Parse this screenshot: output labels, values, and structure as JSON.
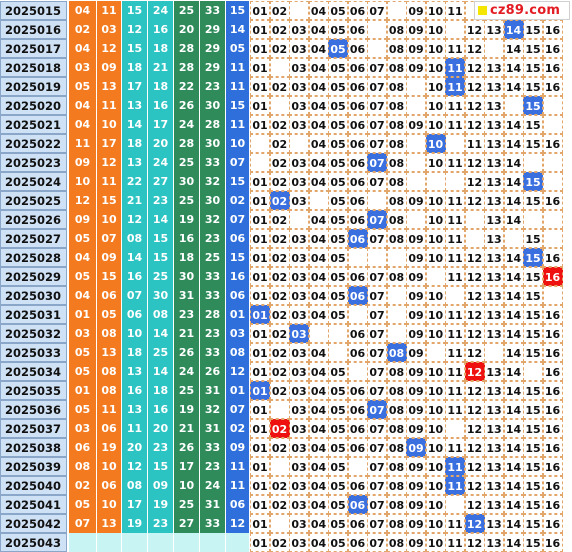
{
  "site": {
    "logo_text": "cz89.com"
  },
  "colors": {
    "orange": "#f47a1f",
    "teal": "#2cc3c3",
    "green": "#2f8c5a",
    "blue_ball": "#2f6fdc",
    "highlight_red": "#ef1010",
    "period_bg": "#cfe1f5",
    "empty_red_bg": "#c9f4f4"
  },
  "rows": [
    {
      "period": "2025015",
      "reds": [
        "04",
        "11",
        "15",
        "24",
        "25",
        "33"
      ],
      "blue": "15",
      "dist": [
        "01",
        "02",
        "",
        "04",
        "05",
        "06",
        "07",
        "",
        "09",
        "10",
        "11",
        "",
        "",
        "",
        "",
        ""
      ],
      "hits": []
    },
    {
      "period": "2025016",
      "reds": [
        "02",
        "03",
        "12",
        "16",
        "20",
        "29"
      ],
      "blue": "14",
      "dist": [
        "01",
        "02",
        "03",
        "04",
        "05",
        "06",
        "",
        "08",
        "09",
        "10",
        "",
        "12",
        "13",
        "14",
        "15",
        "16"
      ],
      "hits": [
        14
      ]
    },
    {
      "period": "2025017",
      "reds": [
        "04",
        "12",
        "15",
        "18",
        "28",
        "29"
      ],
      "blue": "05",
      "dist": [
        "01",
        "02",
        "03",
        "04",
        "05",
        "06",
        "",
        "08",
        "09",
        "10",
        "11",
        "12",
        "",
        "14",
        "15",
        "16"
      ],
      "hits": [
        5
      ]
    },
    {
      "period": "2025018",
      "reds": [
        "03",
        "09",
        "18",
        "21",
        "28",
        "29"
      ],
      "blue": "11",
      "dist": [
        "01",
        "",
        "03",
        "04",
        "05",
        "06",
        "07",
        "08",
        "09",
        "10",
        "11",
        "12",
        "13",
        "14",
        "15",
        "16"
      ],
      "hits": [
        11
      ]
    },
    {
      "period": "2025019",
      "reds": [
        "05",
        "13",
        "17",
        "18",
        "22",
        "23"
      ],
      "blue": "11",
      "dist": [
        "01",
        "02",
        "03",
        "04",
        "05",
        "06",
        "07",
        "08",
        "",
        "10",
        "11",
        "12",
        "13",
        "14",
        "15",
        "16"
      ],
      "hits": [
        11
      ]
    },
    {
      "period": "2025020",
      "reds": [
        "04",
        "11",
        "13",
        "16",
        "26",
        "30"
      ],
      "blue": "15",
      "dist": [
        "01",
        "",
        "03",
        "04",
        "05",
        "06",
        "07",
        "08",
        "",
        "10",
        "11",
        "12",
        "13",
        "",
        "15",
        ""
      ],
      "hits": [
        15
      ]
    },
    {
      "period": "2025021",
      "reds": [
        "04",
        "10",
        "14",
        "17",
        "24",
        "28"
      ],
      "blue": "11",
      "dist": [
        "01",
        "02",
        "03",
        "04",
        "05",
        "06",
        "07",
        "08",
        "09",
        "10",
        "11",
        "12",
        "13",
        "14",
        "15",
        ""
      ],
      "hits": []
    },
    {
      "period": "2025022",
      "reds": [
        "11",
        "17",
        "18",
        "20",
        "28",
        "30"
      ],
      "blue": "10",
      "dist": [
        "",
        "02",
        "",
        "04",
        "05",
        "06",
        "07",
        "08",
        "",
        "10",
        "",
        "11",
        "13",
        "14",
        "15",
        "16"
      ],
      "hits": [
        10
      ]
    },
    {
      "period": "2025023",
      "reds": [
        "09",
        "12",
        "13",
        "24",
        "25",
        "33"
      ],
      "blue": "07",
      "dist": [
        "",
        "02",
        "03",
        "04",
        "05",
        "06",
        "07",
        "08",
        "",
        "10",
        "11",
        "12",
        "13",
        "14",
        "",
        ""
      ],
      "hits": [
        7
      ]
    },
    {
      "period": "2025024",
      "reds": [
        "10",
        "11",
        "22",
        "27",
        "30",
        "32"
      ],
      "blue": "15",
      "dist": [
        "01",
        "02",
        "03",
        "04",
        "05",
        "06",
        "07",
        "08",
        "",
        "",
        "",
        "12",
        "13",
        "14",
        "15",
        ""
      ],
      "hits": [
        15
      ]
    },
    {
      "period": "2025025",
      "reds": [
        "12",
        "15",
        "21",
        "23",
        "25",
        "30"
      ],
      "blue": "02",
      "dist": [
        "01",
        "02",
        "03",
        "",
        "05",
        "06",
        "",
        "08",
        "09",
        "10",
        "11",
        "12",
        "13",
        "14",
        "15",
        "16"
      ],
      "hits": [
        2
      ]
    },
    {
      "period": "2025026",
      "reds": [
        "09",
        "10",
        "12",
        "14",
        "19",
        "32"
      ],
      "blue": "07",
      "dist": [
        "01",
        "02",
        "",
        "04",
        "05",
        "06",
        "07",
        "08",
        "",
        "10",
        "11",
        "",
        "13",
        "14",
        "",
        ""
      ],
      "hits": [
        7
      ]
    },
    {
      "period": "2025027",
      "reds": [
        "05",
        "07",
        "08",
        "15",
        "16",
        "23"
      ],
      "blue": "06",
      "dist": [
        "01",
        "02",
        "03",
        "04",
        "05",
        "06",
        "07",
        "08",
        "09",
        "10",
        "11",
        "",
        "13",
        "",
        "15",
        ""
      ],
      "hits": [
        6
      ]
    },
    {
      "period": "2025028",
      "reds": [
        "04",
        "09",
        "14",
        "15",
        "18",
        "25"
      ],
      "blue": "15",
      "dist": [
        "01",
        "02",
        "03",
        "04",
        "05",
        "",
        "",
        "",
        "09",
        "10",
        "11",
        "12",
        "13",
        "14",
        "15",
        "16"
      ],
      "hits": [
        15
      ]
    },
    {
      "period": "2025029",
      "reds": [
        "05",
        "15",
        "16",
        "25",
        "30",
        "33"
      ],
      "blue": "16",
      "dist": [
        "01",
        "02",
        "03",
        "04",
        "05",
        "06",
        "07",
        "08",
        "09",
        "",
        "11",
        "12",
        "13",
        "14",
        "15",
        "16"
      ],
      "hits": [
        16
      ]
    },
    {
      "period": "2025030",
      "reds": [
        "04",
        "06",
        "07",
        "30",
        "31",
        "33"
      ],
      "blue": "06",
      "dist": [
        "01",
        "02",
        "03",
        "04",
        "05",
        "06",
        "07",
        "",
        "09",
        "10",
        "",
        "12",
        "13",
        "14",
        "15",
        ""
      ],
      "hits": [
        6
      ]
    },
    {
      "period": "2025031",
      "reds": [
        "01",
        "05",
        "06",
        "08",
        "23",
        "28"
      ],
      "blue": "01",
      "dist": [
        "01",
        "02",
        "03",
        "04",
        "05",
        "",
        "07",
        "",
        "09",
        "10",
        "11",
        "12",
        "13",
        "14",
        "15",
        "16"
      ],
      "hits": [
        1
      ]
    },
    {
      "period": "2025032",
      "reds": [
        "03",
        "08",
        "10",
        "14",
        "21",
        "23"
      ],
      "blue": "03",
      "dist": [
        "01",
        "02",
        "03",
        "",
        "",
        "06",
        "07",
        "",
        "09",
        "10",
        "11",
        "12",
        "13",
        "14",
        "15",
        "16"
      ],
      "hits": [
        3
      ]
    },
    {
      "period": "2025033",
      "reds": [
        "05",
        "13",
        "18",
        "25",
        "26",
        "33"
      ],
      "blue": "08",
      "dist": [
        "01",
        "02",
        "03",
        "04",
        "",
        "06",
        "07",
        "08",
        "09",
        "",
        "11",
        "12",
        "",
        "14",
        "15",
        "16"
      ],
      "hits": [
        8
      ]
    },
    {
      "period": "2025034",
      "reds": [
        "05",
        "08",
        "13",
        "14",
        "24",
        "26"
      ],
      "blue": "12",
      "dist": [
        "01",
        "02",
        "03",
        "04",
        "05",
        "",
        "07",
        "08",
        "09",
        "10",
        "11",
        "12",
        "13",
        "14",
        "",
        "16"
      ],
      "hits": [
        12
      ]
    },
    {
      "period": "2025035",
      "reds": [
        "01",
        "08",
        "16",
        "18",
        "25",
        "31"
      ],
      "blue": "01",
      "dist": [
        "01",
        "02",
        "03",
        "04",
        "05",
        "06",
        "07",
        "08",
        "09",
        "10",
        "11",
        "12",
        "13",
        "14",
        "15",
        "16"
      ],
      "hits": [
        1
      ]
    },
    {
      "period": "2025036",
      "reds": [
        "05",
        "11",
        "13",
        "16",
        "19",
        "32"
      ],
      "blue": "07",
      "dist": [
        "01",
        "",
        "03",
        "04",
        "05",
        "06",
        "07",
        "08",
        "09",
        "10",
        "11",
        "12",
        "13",
        "14",
        "15",
        "16"
      ],
      "hits": [
        7
      ]
    },
    {
      "period": "2025037",
      "reds": [
        "03",
        "06",
        "11",
        "20",
        "21",
        "31"
      ],
      "blue": "02",
      "dist": [
        "01",
        "02",
        "03",
        "04",
        "05",
        "06",
        "07",
        "08",
        "09",
        "10",
        "",
        "12",
        "13",
        "14",
        "15",
        "16"
      ],
      "hits": [
        2
      ]
    },
    {
      "period": "2025038",
      "reds": [
        "06",
        "19",
        "20",
        "23",
        "26",
        "33"
      ],
      "blue": "09",
      "dist": [
        "01",
        "02",
        "03",
        "04",
        "05",
        "06",
        "07",
        "08",
        "09",
        "10",
        "11",
        "12",
        "13",
        "14",
        "15",
        "16"
      ],
      "hits": [
        9
      ]
    },
    {
      "period": "2025039",
      "reds": [
        "08",
        "10",
        "12",
        "15",
        "17",
        "23"
      ],
      "blue": "11",
      "dist": [
        "01",
        "",
        "03",
        "04",
        "05",
        "",
        "07",
        "08",
        "09",
        "10",
        "11",
        "12",
        "13",
        "14",
        "15",
        "16"
      ],
      "hits": [
        11
      ]
    },
    {
      "period": "2025040",
      "reds": [
        "02",
        "06",
        "08",
        "09",
        "10",
        "24"
      ],
      "blue": "11",
      "dist": [
        "01",
        "02",
        "03",
        "04",
        "05",
        "06",
        "07",
        "08",
        "09",
        "10",
        "11",
        "12",
        "13",
        "14",
        "15",
        "16"
      ],
      "hits": [
        11
      ]
    },
    {
      "period": "2025041",
      "reds": [
        "05",
        "10",
        "17",
        "19",
        "25",
        "31"
      ],
      "blue": "06",
      "dist": [
        "01",
        "02",
        "03",
        "04",
        "05",
        "06",
        "07",
        "08",
        "09",
        "10",
        "",
        "12",
        "13",
        "14",
        "15",
        "16"
      ],
      "hits": [
        6
      ]
    },
    {
      "period": "2025042",
      "reds": [
        "07",
        "13",
        "19",
        "23",
        "27",
        "33"
      ],
      "blue": "12",
      "dist": [
        "01",
        "",
        "03",
        "04",
        "05",
        "06",
        "07",
        "08",
        "09",
        "10",
        "11",
        "12",
        "13",
        "14",
        "15",
        "16"
      ],
      "hits": [
        12
      ]
    },
    {
      "period": "2025043",
      "reds": [
        "",
        "",
        "",
        "",
        "",
        ""
      ],
      "blue": "",
      "dist": [
        "01",
        "02",
        "03",
        "04",
        "05",
        "06",
        "07",
        "08",
        "09",
        "10",
        "11",
        "12",
        "13",
        "14",
        "15",
        "16"
      ],
      "hits": []
    }
  ]
}
